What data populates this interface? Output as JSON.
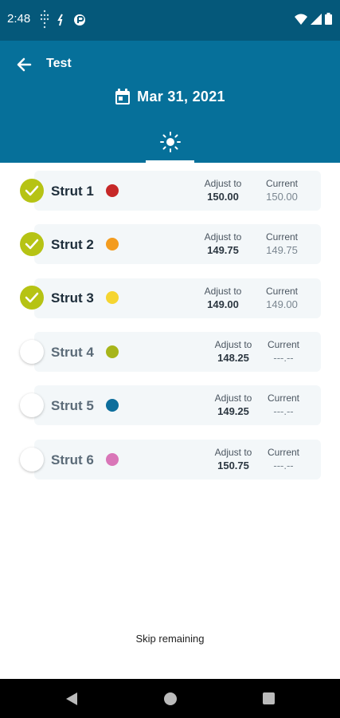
{
  "status_bar": {
    "time": "2:48"
  },
  "header": {
    "title": "Test",
    "date": "Mar 31, 2021",
    "tab_icon": "sun-icon"
  },
  "struts": [
    {
      "name": "Strut 1",
      "color": "#c62828",
      "completed": true,
      "adjust_label": "Adjust to",
      "adjust_value": "150.00",
      "current_label": "Current",
      "current_value": "150.00"
    },
    {
      "name": "Strut 2",
      "color": "#f39c1f",
      "completed": true,
      "adjust_label": "Adjust to",
      "adjust_value": "149.75",
      "current_label": "Current",
      "current_value": "149.75"
    },
    {
      "name": "Strut 3",
      "color": "#f5d531",
      "completed": true,
      "adjust_label": "Adjust to",
      "adjust_value": "149.00",
      "current_label": "Current",
      "current_value": "149.00"
    },
    {
      "name": "Strut 4",
      "color": "#a7b51a",
      "completed": false,
      "adjust_label": "Adjust to",
      "adjust_value": "148.25",
      "current_label": "Current",
      "current_value": "---.--"
    },
    {
      "name": "Strut 5",
      "color": "#0d6e9c",
      "completed": false,
      "adjust_label": "Adjust to",
      "adjust_value": "149.25",
      "current_label": "Current",
      "current_value": "---.--"
    },
    {
      "name": "Strut 6",
      "color": "#d976b8",
      "completed": false,
      "adjust_label": "Adjust to",
      "adjust_value": "150.75",
      "current_label": "Current",
      "current_value": "---.--"
    }
  ],
  "footer": {
    "skip_label": "Skip remaining"
  },
  "colors": {
    "status_bar": "#05587a",
    "app_bar": "#06709a",
    "check_done": "#b6c314"
  }
}
